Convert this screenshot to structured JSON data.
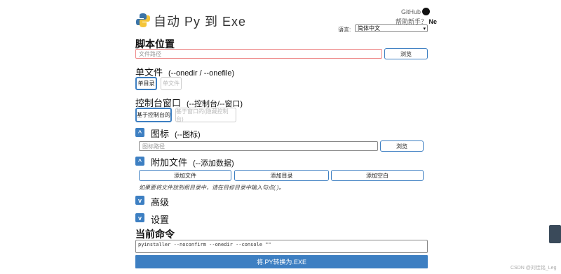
{
  "header": {
    "title": "自动 Py 到 Exe",
    "github_label": "GitHub",
    "help_prefix": "帮助新手？",
    "help_suffix": "Ne",
    "language_label": "语言:",
    "language_value": "简体中文"
  },
  "script_location": {
    "heading": "脚本位置",
    "placeholder": "文件路径",
    "browse_label": "浏览"
  },
  "onefile": {
    "heading": "单文件",
    "hint": "(--onedir / --onefile)",
    "onedir_label": "单目录",
    "onefile_label": "单文件"
  },
  "console": {
    "heading": "控制台窗口",
    "hint": "(--控制台/--窗口)",
    "console_label": "基于控制台的",
    "window_label": "基于窗口的(隐藏控制台)"
  },
  "icon": {
    "heading": "图标",
    "hint": "(--图标)",
    "placeholder": "图标路径",
    "browse_label": "浏览"
  },
  "additional": {
    "heading": "附加文件",
    "hint": "(--添加数据)",
    "add_files": "添加文件",
    "add_folder": "添加目录",
    "add_blank": "添加空白",
    "note": "如果要将文件放到根目录中，请在目标目录中输入句点(.)。"
  },
  "advanced": {
    "heading": "高级"
  },
  "settings": {
    "heading": "设置"
  },
  "current_command": {
    "heading": "当前命令",
    "value": "pyinstaller --noconfirm --onedir --console  \"\""
  },
  "convert_label": "将.PY转换为.EXE",
  "watermark": "CSDN @刘佳铭_Leg"
}
